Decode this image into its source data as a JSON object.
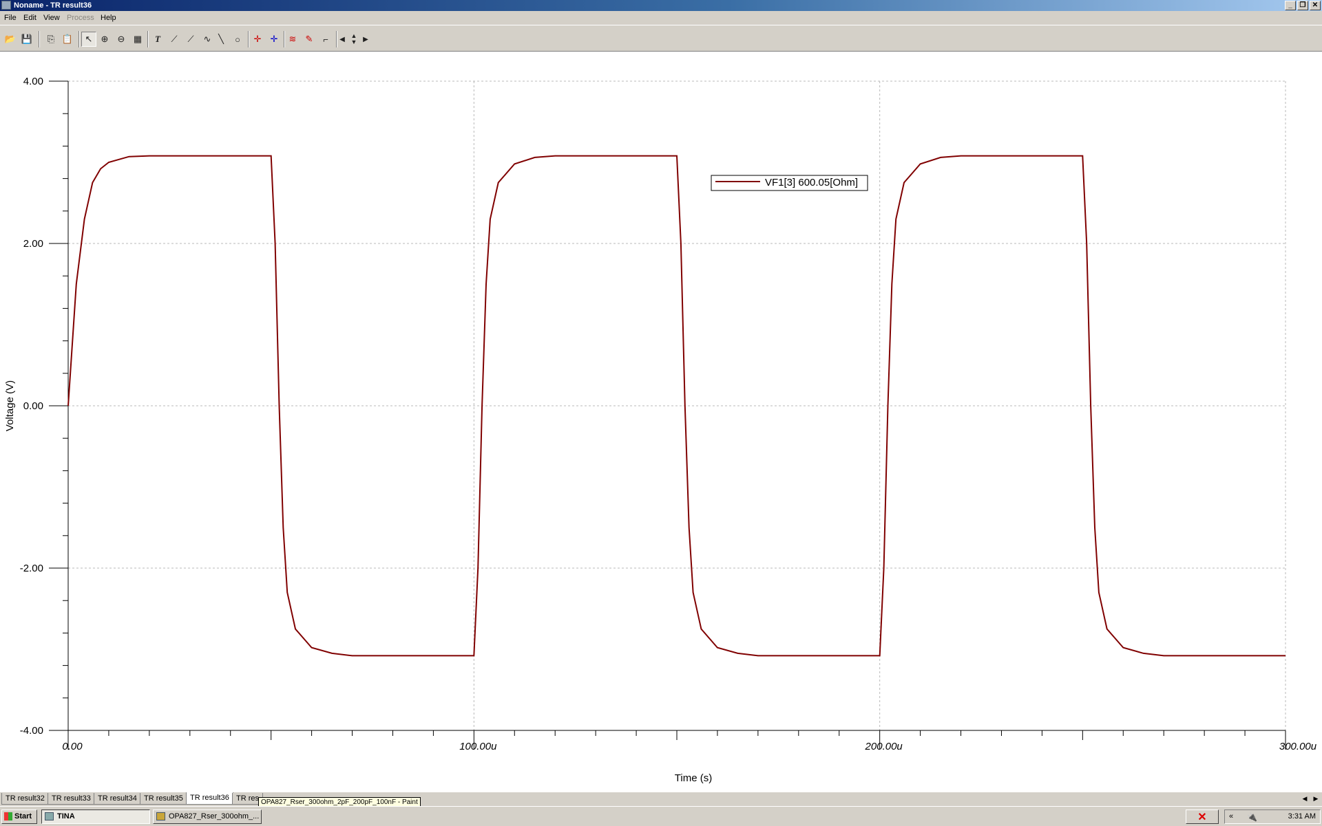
{
  "window": {
    "title": "Noname - TR result36"
  },
  "menu": {
    "items": [
      "File",
      "Edit",
      "View",
      "Process",
      "Help"
    ]
  },
  "toolbar": {
    "icons": [
      "open-icon",
      "save-icon",
      "copy-icon",
      "paste-icon",
      "pointer-icon",
      "zoom-in-icon",
      "zoom-out-icon",
      "grid-icon",
      "text-icon",
      "curve-icon",
      "curve-label-icon",
      "wave-icon",
      "line-icon",
      "circle-icon",
      "cursor-a-icon",
      "cursor-b-icon",
      "trace-icon",
      "marker-icon",
      "pulse-icon",
      "arrow-left-icon",
      "arrow-up-down-icon",
      "arrow-right-icon"
    ]
  },
  "chart_data": {
    "type": "line",
    "xlabel": "Time (s)",
    "ylabel": "Voltage (V)",
    "xlim": [
      0,
      0.0003
    ],
    "ylim": [
      -4,
      4
    ],
    "x_tick_labels": [
      "0.00",
      "100.00u",
      "200.00u",
      "300.00u"
    ],
    "y_tick_labels": [
      "4.00",
      "2.00",
      "0.00",
      "-2.00",
      "-4.00"
    ],
    "grid": true,
    "legend_position": "top-right",
    "series": [
      {
        "name": "VF1[3]  600.05[Ohm]",
        "color": "#800000",
        "x": [
          0,
          2e-06,
          4e-06,
          6e-06,
          8e-06,
          1e-05,
          1.5e-05,
          2e-05,
          5e-05,
          5.1e-05,
          5.2e-05,
          5.3e-05,
          5.4e-05,
          5.6e-05,
          6e-05,
          6.5e-05,
          7e-05,
          0.0001,
          0.000101,
          0.000102,
          0.000103,
          0.000104,
          0.000106,
          0.00011,
          0.000115,
          0.00012,
          0.00015,
          0.000151,
          0.000152,
          0.000153,
          0.000154,
          0.000156,
          0.00016,
          0.000165,
          0.00017,
          0.0002,
          0.000201,
          0.000202,
          0.000203,
          0.000204,
          0.000206,
          0.00021,
          0.000215,
          0.00022,
          0.00025,
          0.000251,
          0.000252,
          0.000253,
          0.000254,
          0.000256,
          0.00026,
          0.000265,
          0.00027,
          0.0003
        ],
        "y": [
          0,
          1.5,
          2.3,
          2.75,
          2.92,
          3.0,
          3.07,
          3.08,
          3.08,
          2.0,
          0.0,
          -1.5,
          -2.3,
          -2.75,
          -2.98,
          -3.05,
          -3.08,
          -3.08,
          -2.0,
          0.0,
          1.5,
          2.3,
          2.75,
          2.98,
          3.06,
          3.08,
          3.08,
          2.0,
          0.0,
          -1.5,
          -2.3,
          -2.75,
          -2.98,
          -3.05,
          -3.08,
          -3.08,
          -2.0,
          0.0,
          1.5,
          2.3,
          2.75,
          2.98,
          3.06,
          3.08,
          3.08,
          2.0,
          0.0,
          -1.5,
          -2.3,
          -2.75,
          -2.98,
          -3.05,
          -3.08,
          -3.08
        ]
      }
    ]
  },
  "tabs": {
    "items": [
      "TR result32",
      "TR result33",
      "TR result34",
      "TR result35",
      "TR result36",
      "TR res"
    ],
    "active_index": 4
  },
  "tooltip": {
    "text": "OPA827_Rser_300ohm_2pF_200pF_100nF - Paint"
  },
  "taskbar": {
    "start_label": "Start",
    "tasks": [
      {
        "label": "TINA",
        "active": true
      },
      {
        "label": "OPA827_Rser_300ohm_...",
        "active": false
      }
    ],
    "clock": "3:31 AM"
  }
}
